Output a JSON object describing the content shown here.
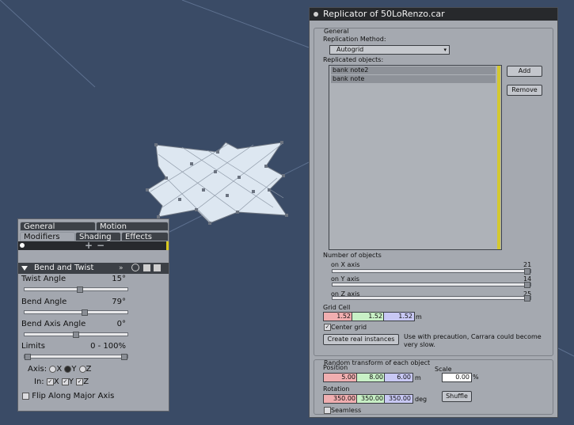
{
  "left_panel": {
    "tabs_row1": [
      "General",
      "Motion"
    ],
    "tabs_row2": [
      "Modifiers",
      "Shading",
      "Effects"
    ],
    "plus": "+",
    "minus": "−",
    "section_title": "Bend and Twist",
    "twist_angle": {
      "label": "Twist Angle",
      "value": "15°",
      "fill": 0.54
    },
    "bend_angle": {
      "label": "Bend Angle",
      "value": "79°",
      "fill": 0.59
    },
    "bend_axis_angle": {
      "label": "Bend Axis Angle",
      "value": "0°",
      "fill": 0.5
    },
    "limits": {
      "label": "Limits",
      "value": "0 - 100%",
      "fill_low": 0.0,
      "fill_high": 1.0
    },
    "axis": {
      "label": "Axis:",
      "options": [
        "X",
        "Y",
        "Z"
      ],
      "selected": "Y"
    },
    "in": {
      "label": "In:",
      "options": [
        "X",
        "Y",
        "Z"
      ],
      "checked": [
        "X",
        "Y",
        "Z"
      ]
    },
    "flip_label": "Flip Along Major Axis"
  },
  "replicator": {
    "title": "Replicator of 50LoRenzo.car",
    "general_label": "General",
    "method_label": "Replication Method:",
    "method_value": "Autogrid",
    "replicated_label": "Replicated objects:",
    "items": [
      "bank note2",
      "bank note"
    ],
    "add_button": "Add",
    "remove_button": "Remove",
    "number_label": "Number of objects",
    "axes": [
      {
        "label": "on X axis",
        "value": "21",
        "fill": 1.0
      },
      {
        "label": "on Y axis",
        "value": "14",
        "fill": 1.0
      },
      {
        "label": "on Z axis",
        "value": "25",
        "fill": 1.0
      }
    ],
    "grid_cell_label": "Grid Cell",
    "grid_cell": [
      "1.52",
      "1.52",
      "1.52"
    ],
    "grid_unit": "m",
    "center_grid_label": "Center grid",
    "create_button": "Create real instances",
    "create_note": "Use with precaution, Carrara could become very slow.",
    "random_label": "Random transform of each object",
    "position_label": "Position",
    "position": [
      "5.00",
      "8.00",
      "6.00"
    ],
    "position_unit": "m",
    "scale_label": "Scale",
    "scale_value": "0.00",
    "scale_unit": "%",
    "rotation_label": "Rotation",
    "rotation": [
      "350.00",
      "350.00",
      "350.00"
    ],
    "rotation_unit": "deg",
    "shuffle_button": "Shuffle",
    "seamless_label": "Seamless"
  }
}
